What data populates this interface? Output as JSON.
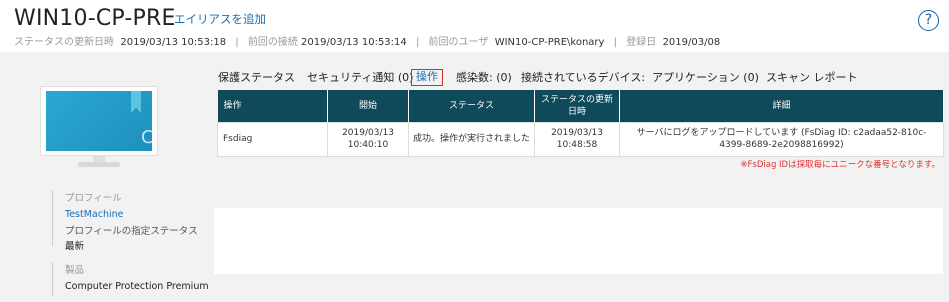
{
  "header": {
    "title": "WIN10-CP-PRE",
    "alias_link": "エイリアスを追加",
    "meta": {
      "status_updated_label": "ステータスの更新日時",
      "status_updated_value": "2019/03/13 10:53:18",
      "last_connection_label": "前回の接続",
      "last_connection_value": "2019/03/13 10:53:14",
      "last_user_label": "前回のユーザ",
      "last_user_value": "WIN10-CP-PRE\\konary",
      "registered_label": "登録日",
      "registered_value": "2019/03/08"
    },
    "help_icon": "?"
  },
  "computer": {
    "badge_letter": "C"
  },
  "profile": {
    "section_label": "プロフィール",
    "link": "TestMachine",
    "caption": "プロフィールの指定ステータス",
    "value": "最新"
  },
  "product": {
    "section_label": "製品",
    "value": "Computer Protection Premium"
  },
  "tabs": [
    {
      "label": "保護ステータス"
    },
    {
      "label": "セキュリティ通知 (0)"
    },
    {
      "label": "操作",
      "active": true
    },
    {
      "label": "感染数: (0)"
    },
    {
      "label": "接続されているデバイス:"
    },
    {
      "label": "アプリケーション (0)"
    },
    {
      "label": "スキャン レポート"
    }
  ],
  "table": {
    "headers": [
      "操作",
      "開始",
      "ステータス",
      "ステータスの更新日時",
      "詳細"
    ],
    "rows": [
      {
        "operation": "Fsdiag",
        "start": "2019/03/13 10:40:10",
        "status": "成功。操作が実行されました",
        "updated": "2019/03/13 10:48:58",
        "detail": "サーバにログをアップロードしています (FsDiag ID: c2adaa52-810c-4399-8689-2e2098816992)"
      }
    ]
  },
  "note": "※FsDiag IDは採取毎にユニークな番号となります。",
  "colors": {
    "accent_link": "#1a6fb5",
    "table_header": "#0f4a5a",
    "highlight": "#d32f2f",
    "note": "#e03030"
  }
}
